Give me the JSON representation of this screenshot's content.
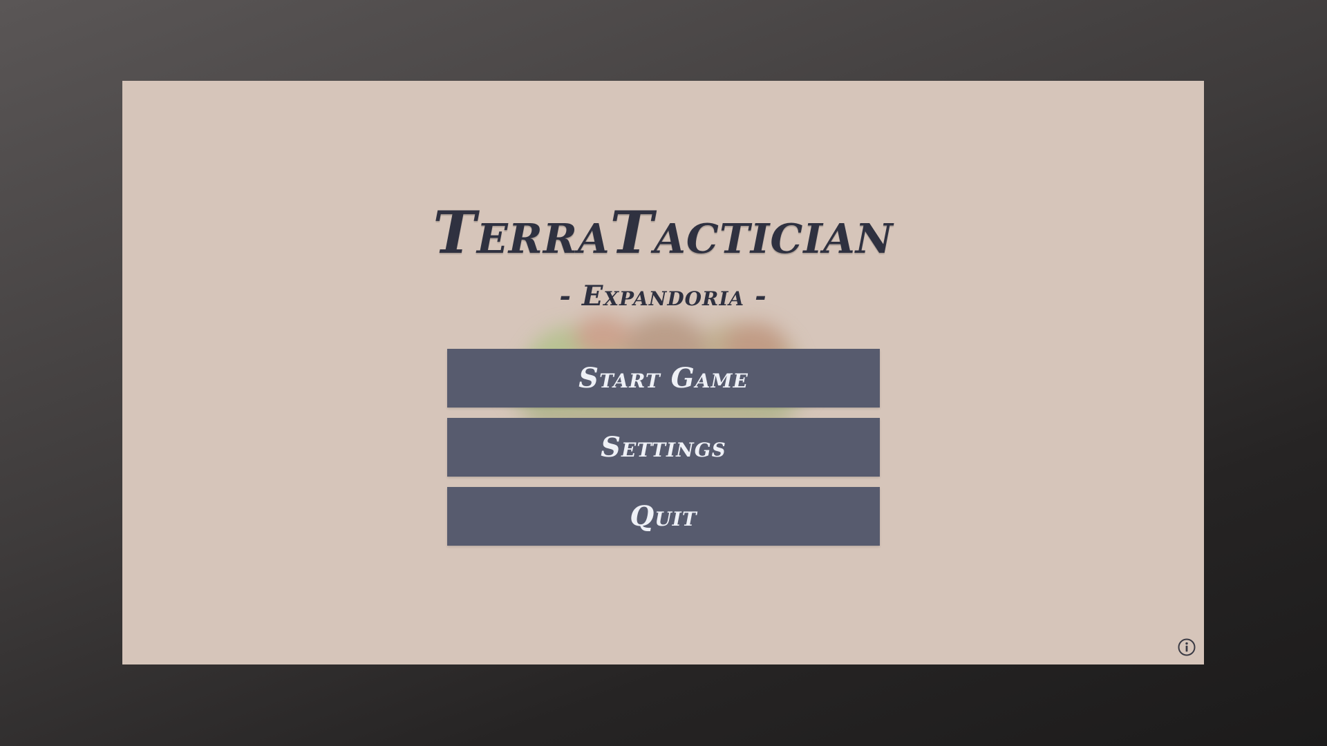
{
  "game": {
    "title": "TerraTactician",
    "subtitle": "- Expandoria -"
  },
  "menu": {
    "items": [
      {
        "label": "Start Game"
      },
      {
        "label": "Settings"
      },
      {
        "label": "Quit"
      }
    ]
  },
  "icons": {
    "info": "info-icon"
  },
  "colors": {
    "frame_background": "#d6c5ba",
    "button_background": "#575b6e",
    "button_text": "#eef0f6",
    "title_text": "#2f3140"
  }
}
